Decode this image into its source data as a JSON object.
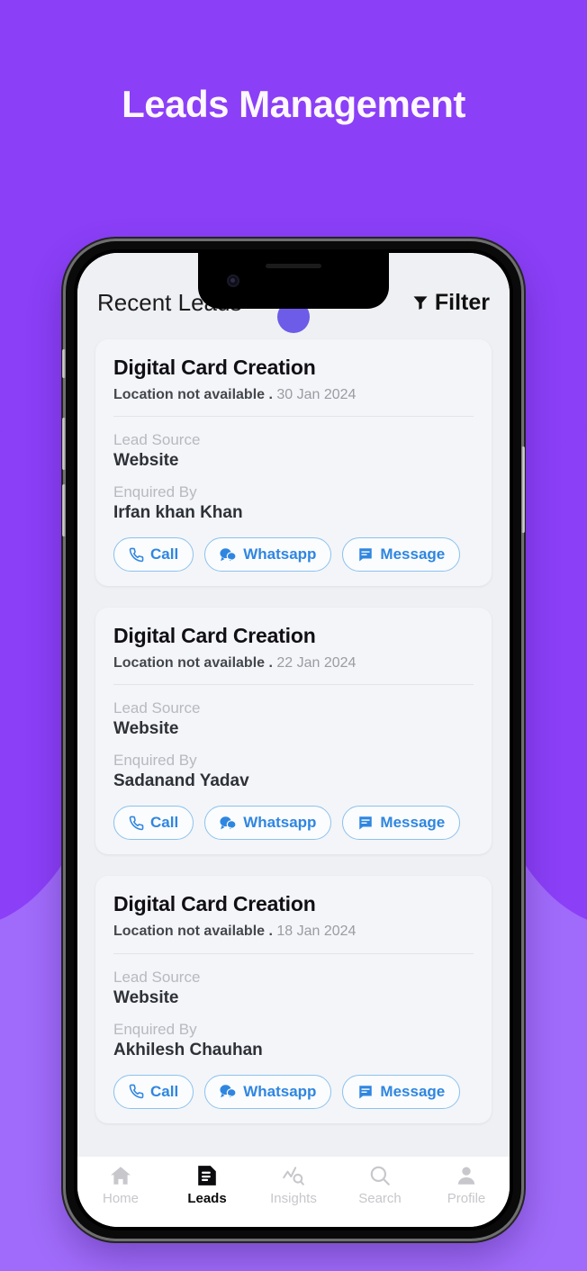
{
  "banner": {
    "title": "Leads Management",
    "background_color": "#8b3ff7",
    "title_color": "#fdf7ff"
  },
  "app": {
    "header": {
      "title": "Recent Leads",
      "filter_label": "Filter",
      "filter_icon": "funnel-icon"
    },
    "accent_color": "#2f86e0",
    "screen_background": "#eff0f3",
    "cards": [
      {
        "title": "Digital Card Creation",
        "location": "Location not available .",
        "date": "30 Jan 2024",
        "lead_source_label": "Lead Source",
        "lead_source_value": "Website",
        "enquired_by_label": "Enquired By",
        "enquired_by_value": "Irfan khan Khan",
        "actions": [
          {
            "label": "Call",
            "icon": "phone-icon"
          },
          {
            "label": "Whatsapp",
            "icon": "whatsapp-icon"
          },
          {
            "label": "Message",
            "icon": "message-icon"
          }
        ]
      },
      {
        "title": "Digital Card Creation",
        "location": "Location not available .",
        "date": "22 Jan 2024",
        "lead_source_label": "Lead Source",
        "lead_source_value": "Website",
        "enquired_by_label": "Enquired By",
        "enquired_by_value": "Sadanand Yadav",
        "actions": [
          {
            "label": "Call",
            "icon": "phone-icon"
          },
          {
            "label": "Whatsapp",
            "icon": "whatsapp-icon"
          },
          {
            "label": "Message",
            "icon": "message-icon"
          }
        ]
      },
      {
        "title": "Digital Card Creation",
        "location": "Location not available .",
        "date": "18 Jan 2024",
        "lead_source_label": "Lead Source",
        "lead_source_value": "Website",
        "enquired_by_label": "Enquired By",
        "enquired_by_value": "Akhilesh Chauhan",
        "actions": [
          {
            "label": "Call",
            "icon": "phone-icon"
          },
          {
            "label": "Whatsapp",
            "icon": "whatsapp-icon"
          },
          {
            "label": "Message",
            "icon": "message-icon"
          }
        ]
      }
    ],
    "bottom_nav": {
      "active": "Leads",
      "items": [
        {
          "label": "Home",
          "icon": "home-icon",
          "active": false
        },
        {
          "label": "Leads",
          "icon": "document-icon",
          "active": true
        },
        {
          "label": "Insights",
          "icon": "chart-search-icon",
          "active": false
        },
        {
          "label": "Search",
          "icon": "search-icon",
          "active": false
        },
        {
          "label": "Profile",
          "icon": "person-icon",
          "active": false
        }
      ]
    }
  }
}
